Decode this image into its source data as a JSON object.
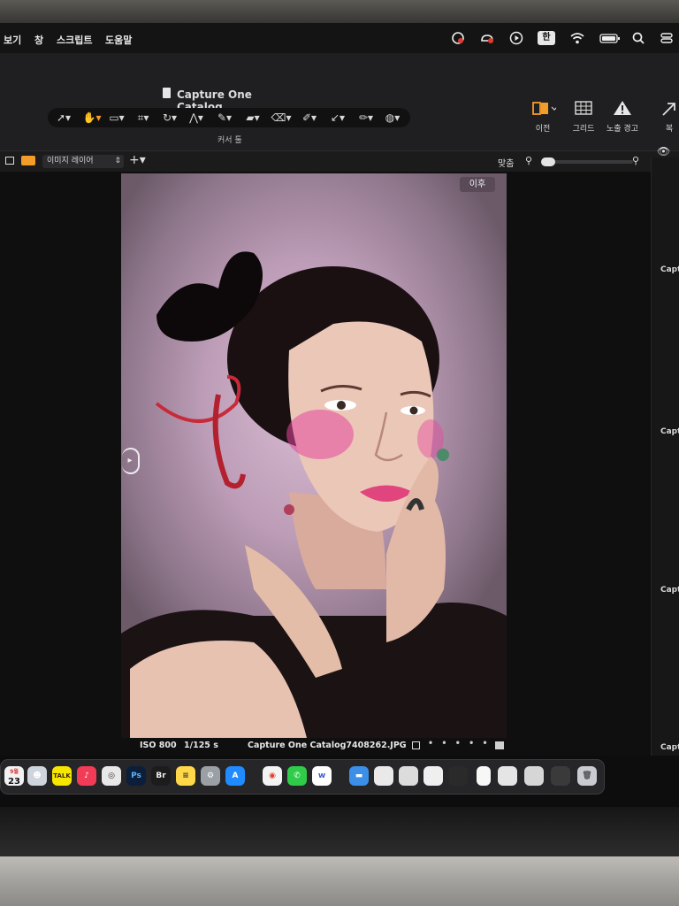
{
  "menubar": {
    "items": [
      "보기",
      "창",
      "스크립트",
      "도움말"
    ],
    "input_source": "한"
  },
  "window": {
    "title": "Capture One Catalog"
  },
  "toolbar": {
    "cursor_tools_label": "커서 툴",
    "right_tools": [
      {
        "label": "이전",
        "icon": "compare-icon"
      },
      {
        "label": "그리드",
        "icon": "grid-icon"
      },
      {
        "label": "노출 경고",
        "icon": "warning-icon"
      },
      {
        "label": "복",
        "icon": "arrow-icon"
      }
    ]
  },
  "viewer": {
    "layer_select": "이미지 레이어",
    "fit_label": "맞춤",
    "after_badge": "이후",
    "iso": "ISO 800",
    "shutter": "1/125 s",
    "filename": "Capture One Catalog7408262.JPG"
  },
  "right_panel": {
    "labels": [
      "Capt",
      "Capt",
      "Capt",
      "Capt"
    ]
  },
  "dock": {
    "calendar_month": "9월",
    "calendar_day": "23",
    "apps": [
      {
        "label": "TALK",
        "name": "kakaotalk",
        "color": "#f7e600"
      },
      {
        "label": "Ps",
        "name": "photoshop",
        "color": "#0b1f3b"
      },
      {
        "label": "Br",
        "name": "bridge",
        "color": "#1c1c1c"
      },
      {
        "label": "w",
        "name": "word-app",
        "color": "#ffffff"
      }
    ]
  },
  "colors": {
    "accent_orange": "#f39c2a",
    "menubar_bg": "#141415",
    "toolbar_bg": "#1f1f21"
  }
}
